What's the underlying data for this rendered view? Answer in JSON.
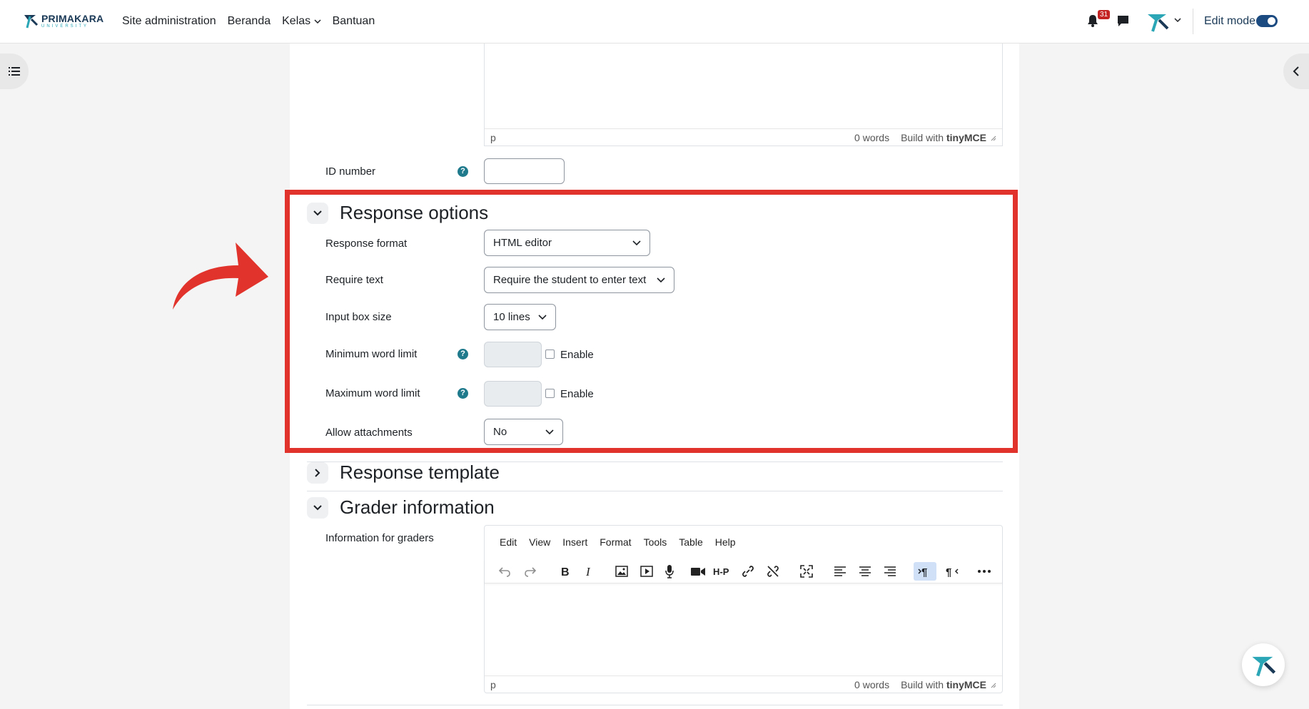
{
  "header": {
    "brand": "PRIMAKARA",
    "brand_sub": "UNIVERSITY",
    "nav": [
      "Site administration",
      "Beranda",
      "Kelas",
      "Bantuan"
    ],
    "notification_count": "31",
    "edit_mode_label": "Edit mode",
    "edit_mode_on": true
  },
  "editor_top": {
    "path": "p",
    "word_count": "0 words",
    "build_with": "Build with",
    "tiny_brand": "tinyMCE"
  },
  "id_number": {
    "label": "ID number",
    "value": ""
  },
  "response_options": {
    "title": "Response options",
    "response_format": {
      "label": "Response format",
      "value": "HTML editor"
    },
    "require_text": {
      "label": "Require text",
      "value": "Require the student to enter text"
    },
    "input_box_size": {
      "label": "Input box size",
      "value": "10 lines"
    },
    "min_word_limit": {
      "label": "Minimum word limit",
      "enable": "Enable"
    },
    "max_word_limit": {
      "label": "Maximum word limit",
      "enable": "Enable"
    },
    "allow_attachments": {
      "label": "Allow attachments",
      "value": "No"
    }
  },
  "response_template": {
    "title": "Response template"
  },
  "grader_information": {
    "title": "Grader information",
    "label": "Information for graders",
    "menu": [
      "Edit",
      "View",
      "Insert",
      "Format",
      "Tools",
      "Table",
      "Help"
    ],
    "path": "p",
    "word_count": "0 words",
    "build_with": "Build with",
    "tiny_brand": "tinyMCE"
  },
  "colors": {
    "highlight": "#e1332b",
    "brand": "#1b3a57",
    "accent": "#1f7a8c",
    "toggle": "#1b4b80"
  }
}
